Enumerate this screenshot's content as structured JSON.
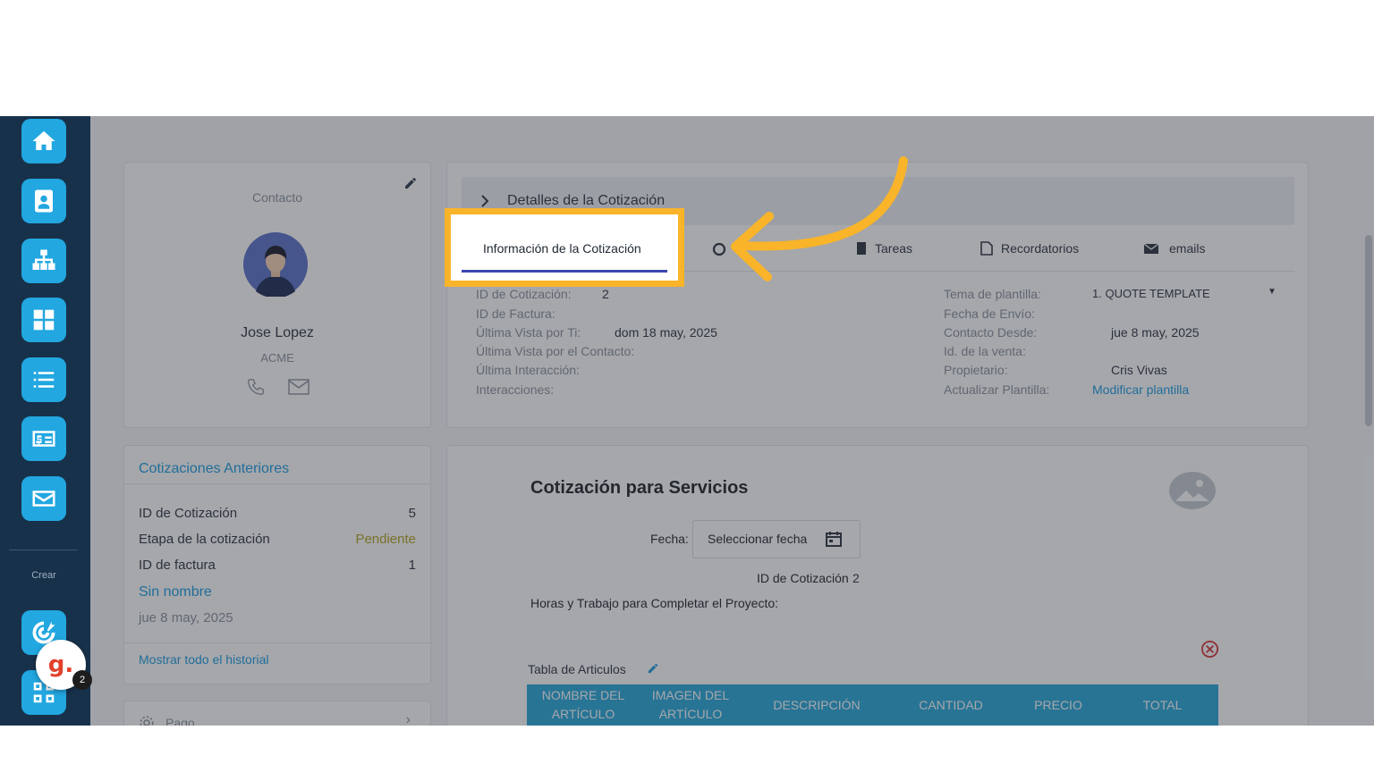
{
  "sidebar": {
    "create_label": "Crear",
    "bubble_letter": "g.",
    "badge_count": "2",
    "icons": [
      "home-icon",
      "contact-card-icon",
      "org-chart-icon",
      "dashboard-icon",
      "list-icon",
      "invoice-icon",
      "mail-icon",
      "target-icon",
      "apps-icon"
    ]
  },
  "contact": {
    "heading": "Contacto",
    "name": "Jose Lopez",
    "company": "ACME"
  },
  "previous_quotes": {
    "title": "Cotizaciones Anteriores",
    "rows": [
      {
        "label": "ID de Cotización",
        "value": "5"
      },
      {
        "label": "Etapa de la cotización",
        "value": "Pendiente"
      },
      {
        "label": "ID de factura",
        "value": "1"
      }
    ],
    "link_name": "Sin nombre",
    "date": "jue 8 may, 2025",
    "show_all": "Mostrar todo el historial",
    "next_section": "Pago"
  },
  "details": {
    "header": "Detalles de la Cotización",
    "tabs": {
      "info": "Información de la Cotización",
      "tasks": "Tareas",
      "reminders": "Recordatorios",
      "emails": "emails"
    },
    "left": [
      {
        "label": "ID de Cotización:",
        "value": "2"
      },
      {
        "label": "ID de Factura:",
        "value": ""
      },
      {
        "label": "Última Vista por Ti:",
        "value": "dom 18 may, 2025"
      },
      {
        "label": "Última Vista por el Contacto:",
        "value": ""
      },
      {
        "label": "Última Interacción:",
        "value": ""
      },
      {
        "label": "Interacciones:",
        "value": ""
      }
    ],
    "right": [
      {
        "label": "Tema de plantilla:",
        "value": "1. QUOTE TEMPLATE"
      },
      {
        "label": "Fecha de Envío:",
        "value": ""
      },
      {
        "label": "Contacto Desde:",
        "value": "jue 8 may, 2025"
      },
      {
        "label": "Id. de la venta:",
        "value": ""
      },
      {
        "label": "Propietario:",
        "value": "Cris Vivas"
      },
      {
        "label": "Actualizar Plantilla:",
        "value": "Modificar plantilla"
      }
    ]
  },
  "quote_doc": {
    "title": "Cotización para Servicios",
    "date_label": "Fecha:",
    "date_placeholder": "Seleccionar fecha",
    "quote_id_label": "ID de Cotización",
    "quote_id_value": "2",
    "hours_label": "Horas y Trabajo para Completar el Proyecto:",
    "table_label": "Tabla de Articulos",
    "columns": [
      [
        "NOMBRE DEL",
        "ARTÍCULO"
      ],
      [
        "IMAGEN DEL",
        "ARTÍCULO"
      ],
      [
        "DESCRIPCIÓN"
      ],
      [
        "CANTIDAD"
      ],
      [
        "PRECIO"
      ],
      [
        "TOTAL"
      ]
    ]
  },
  "colors": {
    "accent": "#f9b429",
    "sidebar": "#17314a",
    "sidebar_button": "#22a7e0",
    "link": "#1e9be0",
    "table_header": "#28a7d9"
  }
}
